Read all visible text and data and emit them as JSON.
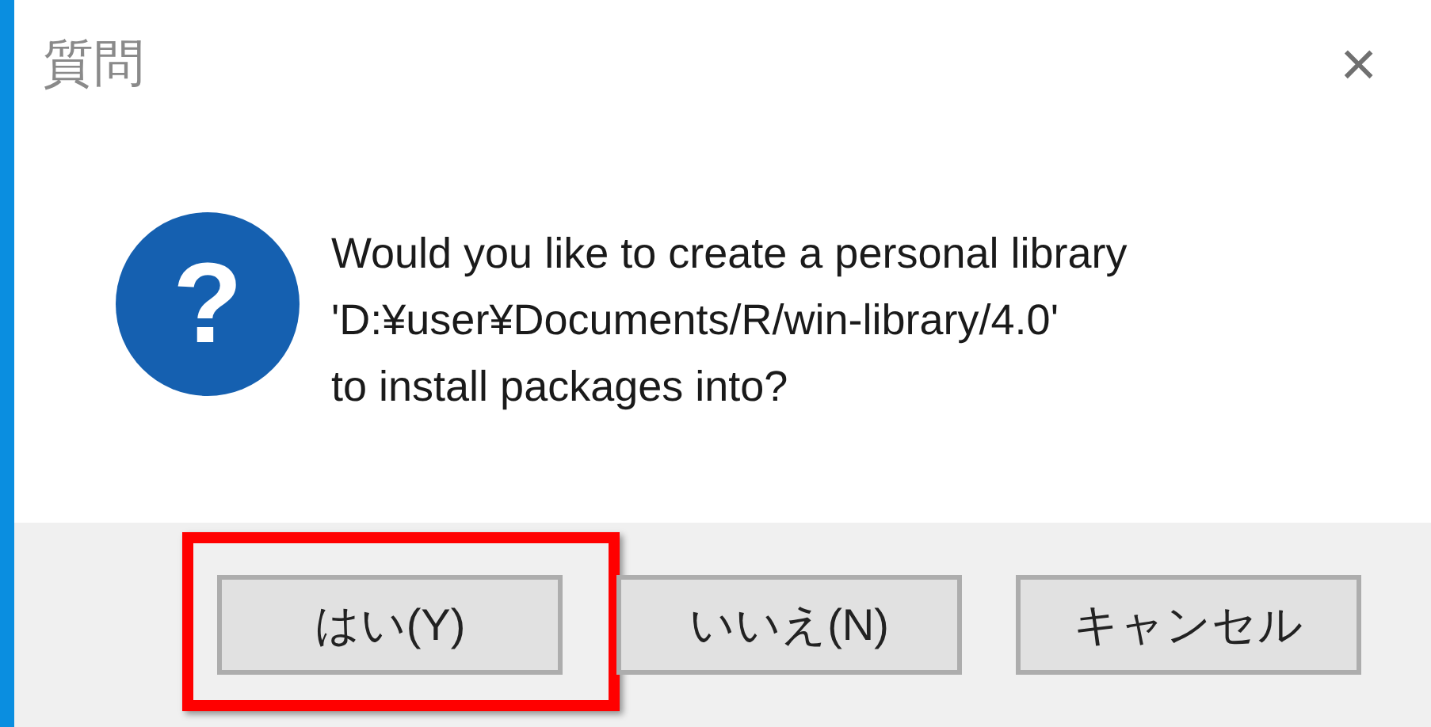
{
  "window": {
    "title": "質問",
    "close": "×"
  },
  "message": {
    "icon": "?",
    "lines": [
      "Would you like to create a personal library",
      "'D:¥user¥Documents/R/win-library/4.0'",
      "to install packages into?"
    ]
  },
  "buttons": [
    {
      "label": "はい(Y)",
      "highlighted": true
    },
    {
      "label": "いいえ(N)",
      "highlighted": false
    },
    {
      "label": "キャンセル",
      "highlighted": false
    }
  ]
}
